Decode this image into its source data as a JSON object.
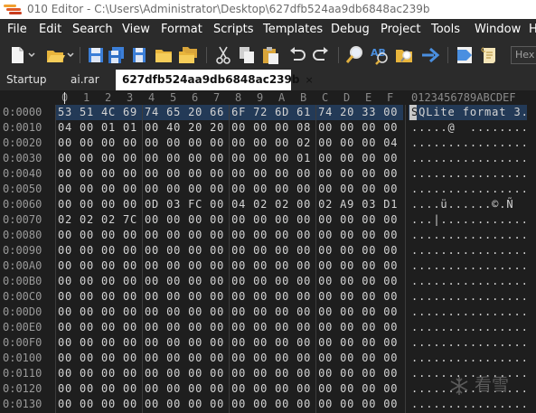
{
  "window": {
    "title": "010 Editor - C:\\Users\\Administrator\\Desktop\\627dfb524aa9db6848ac239b",
    "logo_colors": [
      "#f0a030",
      "#e05a28",
      "#c83c1e"
    ]
  },
  "menu": [
    "File",
    "Edit",
    "Search",
    "View",
    "Format",
    "Scripts",
    "Templates",
    "Debug",
    "Project",
    "Tools",
    "Window",
    "H"
  ],
  "toolbar": {
    "icons": [
      "new-file",
      "open-file",
      "save",
      "save-all",
      "open-folder",
      "open-folder-2",
      "cut",
      "copy",
      "paste",
      "undo",
      "redo",
      "find",
      "replace",
      "find-in-files",
      "goto",
      "template",
      "script"
    ],
    "hex_field": "Hex"
  },
  "tabs": [
    {
      "label": "Startup",
      "active": false
    },
    {
      "label": "ai.rar",
      "active": false
    },
    {
      "label": "627dfb524aa9db6848ac239b",
      "active": true,
      "close": "×"
    }
  ],
  "editor": {
    "col_headers": [
      "0",
      "1",
      "2",
      "3",
      "4",
      "5",
      "6",
      "7",
      "8",
      "9",
      "A",
      "B",
      "C",
      "D",
      "E",
      "F"
    ],
    "ascii_header": "0123456789ABCDEF",
    "rows": [
      {
        "offset": "0:0000",
        "hex": "53 51 4C 69 74 65 20 66 6F 72 6D 61 74 20 33 00",
        "ascii": "SQLite format 3."
      },
      {
        "offset": "0:0010",
        "hex": "04 00 01 01 00 40 20 20 00 00 00 08 00 00 00 00",
        "ascii": ".....@  ........"
      },
      {
        "offset": "0:0020",
        "hex": "00 00 00 00 00 00 00 00 00 00 00 02 00 00 00 04",
        "ascii": "................"
      },
      {
        "offset": "0:0030",
        "hex": "00 00 00 00 00 00 00 00 00 00 00 01 00 00 00 00",
        "ascii": "................"
      },
      {
        "offset": "0:0040",
        "hex": "00 00 00 00 00 00 00 00 00 00 00 00 00 00 00 00",
        "ascii": "................"
      },
      {
        "offset": "0:0050",
        "hex": "00 00 00 00 00 00 00 00 00 00 00 00 00 00 00 00",
        "ascii": "................"
      },
      {
        "offset": "0:0060",
        "hex": "00 00 00 00 0D 03 FC 00 04 02 02 00 02 A9 03 D1",
        "ascii": "....ü......©.Ñ"
      },
      {
        "offset": "0:0070",
        "hex": "02 02 02 7C 00 00 00 00 00 00 00 00 00 00 00 00",
        "ascii": "...|............"
      },
      {
        "offset": "0:0080",
        "hex": "00 00 00 00 00 00 00 00 00 00 00 00 00 00 00 00",
        "ascii": "................"
      },
      {
        "offset": "0:0090",
        "hex": "00 00 00 00 00 00 00 00 00 00 00 00 00 00 00 00",
        "ascii": "................"
      },
      {
        "offset": "0:00A0",
        "hex": "00 00 00 00 00 00 00 00 00 00 00 00 00 00 00 00",
        "ascii": "................"
      },
      {
        "offset": "0:00B0",
        "hex": "00 00 00 00 00 00 00 00 00 00 00 00 00 00 00 00",
        "ascii": "................"
      },
      {
        "offset": "0:00C0",
        "hex": "00 00 00 00 00 00 00 00 00 00 00 00 00 00 00 00",
        "ascii": "................"
      },
      {
        "offset": "0:00D0",
        "hex": "00 00 00 00 00 00 00 00 00 00 00 00 00 00 00 00",
        "ascii": "................"
      },
      {
        "offset": "0:00E0",
        "hex": "00 00 00 00 00 00 00 00 00 00 00 00 00 00 00 00",
        "ascii": "................"
      },
      {
        "offset": "0:00F0",
        "hex": "00 00 00 00 00 00 00 00 00 00 00 00 00 00 00 00",
        "ascii": "................"
      },
      {
        "offset": "0:0100",
        "hex": "00 00 00 00 00 00 00 00 00 00 00 00 00 00 00 00",
        "ascii": "................"
      },
      {
        "offset": "0:0110",
        "hex": "00 00 00 00 00 00 00 00 00 00 00 00 00 00 00 00",
        "ascii": "................"
      },
      {
        "offset": "0:0120",
        "hex": "00 00 00 00 00 00 00 00 00 00 00 00 00 00 00 00",
        "ascii": "................"
      },
      {
        "offset": "0:0130",
        "hex": "00 00 00 00 00 00 00 00 00 00 00 00 00 00 00 00",
        "ascii": "................"
      }
    ]
  },
  "watermark": "看雪",
  "colors": {
    "selection": "#233a57",
    "background": "#1e1e1e",
    "toolbar": "#2b2b2b"
  }
}
